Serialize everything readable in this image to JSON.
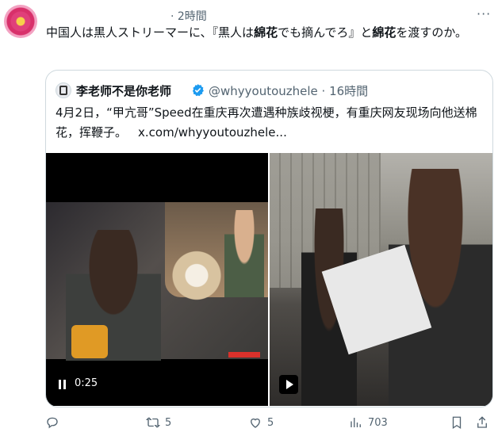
{
  "post": {
    "time": "· 2時間",
    "more_label": "···",
    "text_parts": [
      "中国人は黒人ストリーマーに、『黒人は",
      "綿花",
      "でも摘んでろ』と",
      "綿花",
      "を渡すのか。"
    ]
  },
  "quote": {
    "name": "李老师不是你老师",
    "handle": "@whyyoutouzhele · 16時間",
    "text": "4月2日，“甲亢哥”Speed在重庆再次遭遇种族歧视梗，有重庆网友现场向他送棉花，挥鞭子。",
    "link": "x.com/whyyoutouzhele...",
    "video_time": "0:25"
  },
  "actions": {
    "reply_count": "",
    "repost_count": "5",
    "like_count": "5",
    "views_count": "703"
  },
  "colors": {
    "text": "#0f1419",
    "muted": "#536471",
    "border": "#cfd9de",
    "verified": "#1d9bf0"
  }
}
